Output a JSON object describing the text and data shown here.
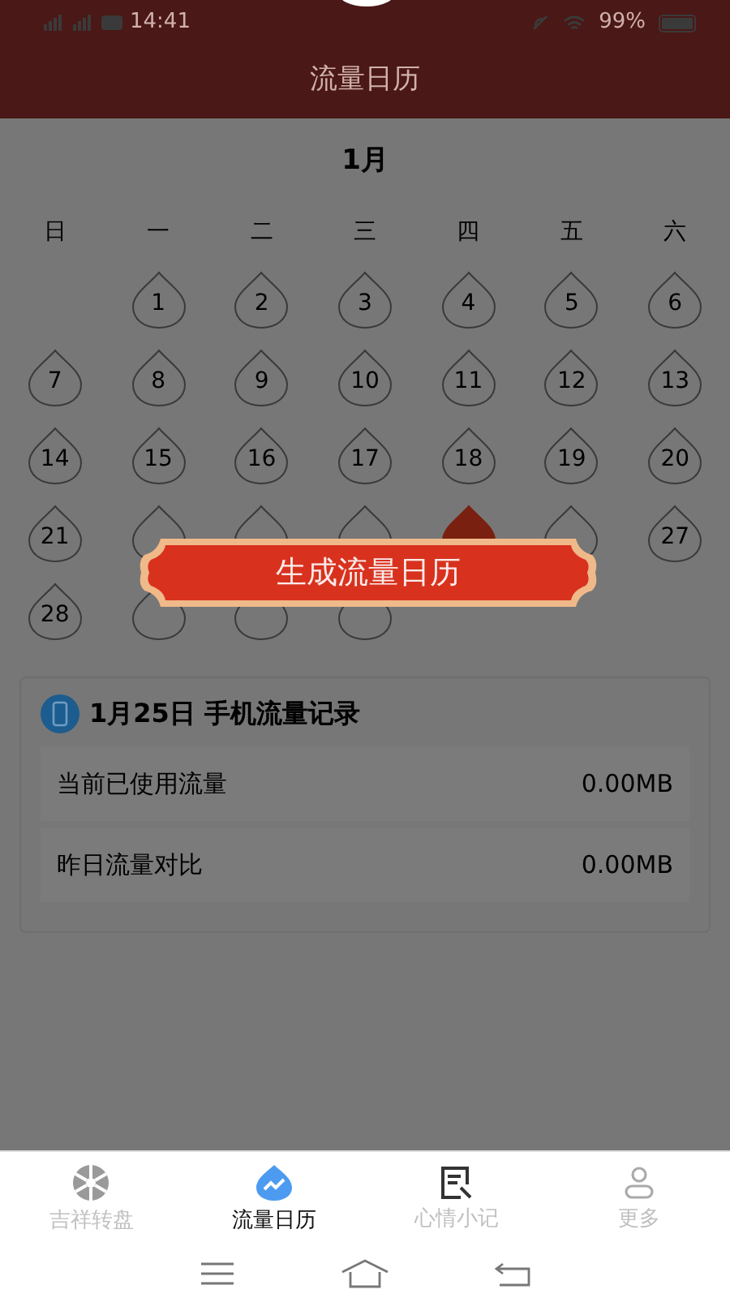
{
  "status_bar": {
    "time": "14:41",
    "battery": "99%"
  },
  "header": {
    "title": "流量日历"
  },
  "calendar": {
    "month": "1月",
    "weekdays": [
      "日",
      "一",
      "二",
      "三",
      "四",
      "五",
      "六"
    ],
    "weeks": [
      [
        {
          "kind": "blank"
        },
        {
          "kind": "day",
          "label": "1",
          "selected": false
        },
        {
          "kind": "day",
          "label": "2",
          "selected": false
        },
        {
          "kind": "day",
          "label": "3",
          "selected": false
        },
        {
          "kind": "day",
          "label": "4",
          "selected": false
        },
        {
          "kind": "day",
          "label": "5",
          "selected": false
        },
        {
          "kind": "day",
          "label": "6",
          "selected": false
        }
      ],
      [
        {
          "kind": "day",
          "label": "7",
          "selected": false
        },
        {
          "kind": "day",
          "label": "8",
          "selected": false
        },
        {
          "kind": "day",
          "label": "9",
          "selected": false
        },
        {
          "kind": "day",
          "label": "10",
          "selected": false
        },
        {
          "kind": "day",
          "label": "11",
          "selected": false
        },
        {
          "kind": "day",
          "label": "12",
          "selected": false
        },
        {
          "kind": "day",
          "label": "13",
          "selected": false
        }
      ],
      [
        {
          "kind": "day",
          "label": "14",
          "selected": false
        },
        {
          "kind": "day",
          "label": "15",
          "selected": false
        },
        {
          "kind": "day",
          "label": "16",
          "selected": false
        },
        {
          "kind": "day",
          "label": "17",
          "selected": false
        },
        {
          "kind": "day",
          "label": "18",
          "selected": false
        },
        {
          "kind": "day",
          "label": "19",
          "selected": false
        },
        {
          "kind": "day",
          "label": "20",
          "selected": false
        }
      ],
      [
        {
          "kind": "day",
          "label": "21",
          "selected": false
        },
        {
          "kind": "day",
          "selected": false
        },
        {
          "kind": "day",
          "selected": false
        },
        {
          "kind": "day",
          "selected": false
        },
        {
          "kind": "day",
          "selected": true
        },
        {
          "kind": "day",
          "selected": false
        },
        {
          "kind": "day",
          "label": "27",
          "selected": false
        }
      ],
      [
        {
          "kind": "day",
          "label": "28",
          "selected": false
        },
        {
          "kind": "day",
          "selected": false
        },
        {
          "kind": "day",
          "selected": false
        },
        {
          "kind": "day",
          "selected": false
        }
      ]
    ]
  },
  "record_card": {
    "title": "1月25日 手机流量记录",
    "rows": [
      {
        "label": "当前已使用流量",
        "value": "0.00MB"
      },
      {
        "label": "昨日流量对比",
        "value": "0.00MB"
      }
    ]
  },
  "dialog": {
    "button": "生成流量日历"
  },
  "bottom_nav": [
    {
      "label": "吉祥转盘",
      "selected": false
    },
    {
      "label": "流量日历",
      "selected": true
    },
    {
      "label": "心情小记",
      "selected": false
    },
    {
      "label": "更多",
      "selected": false
    }
  ]
}
